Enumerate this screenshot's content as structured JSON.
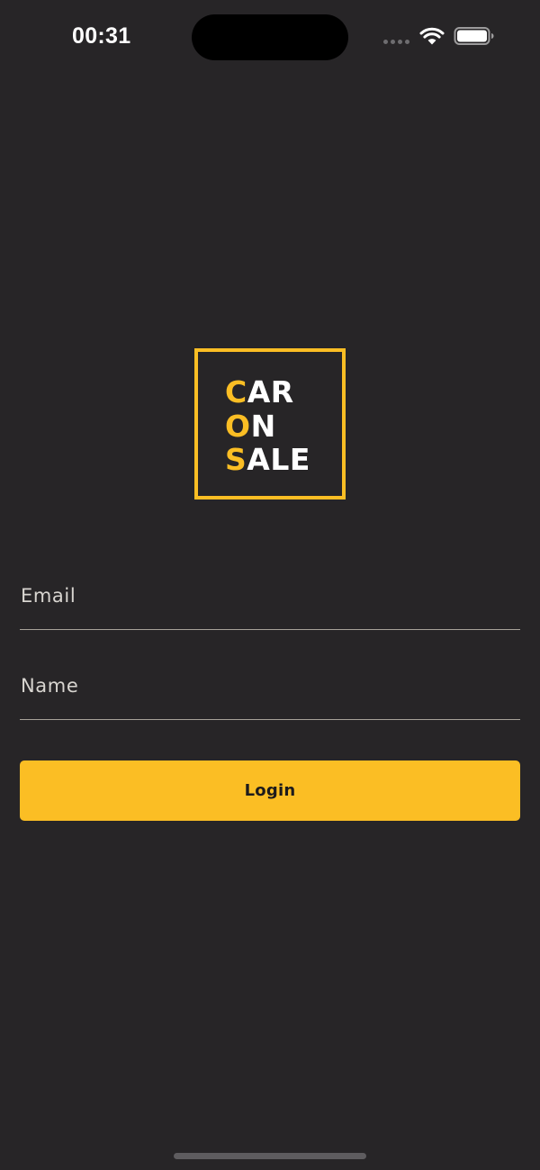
{
  "status_bar": {
    "time": "00:31",
    "cell_icon": "cellular-dots-icon",
    "wifi_icon": "wifi-icon",
    "battery_icon": "battery-icon"
  },
  "logo": {
    "lines": [
      {
        "accent": "C",
        "rest": "AR"
      },
      {
        "accent": "O",
        "rest": "N"
      },
      {
        "accent": "S",
        "rest": "ALE"
      }
    ],
    "accent_color": "#fbbe24",
    "text_color": "#ffffff"
  },
  "form": {
    "email_placeholder": "Email",
    "email_value": "",
    "name_placeholder": "Name",
    "name_value": "",
    "login_label": "Login"
  },
  "colors": {
    "background": "#272527",
    "accent": "#fbbe24",
    "field_underline": "#a8a39a"
  }
}
